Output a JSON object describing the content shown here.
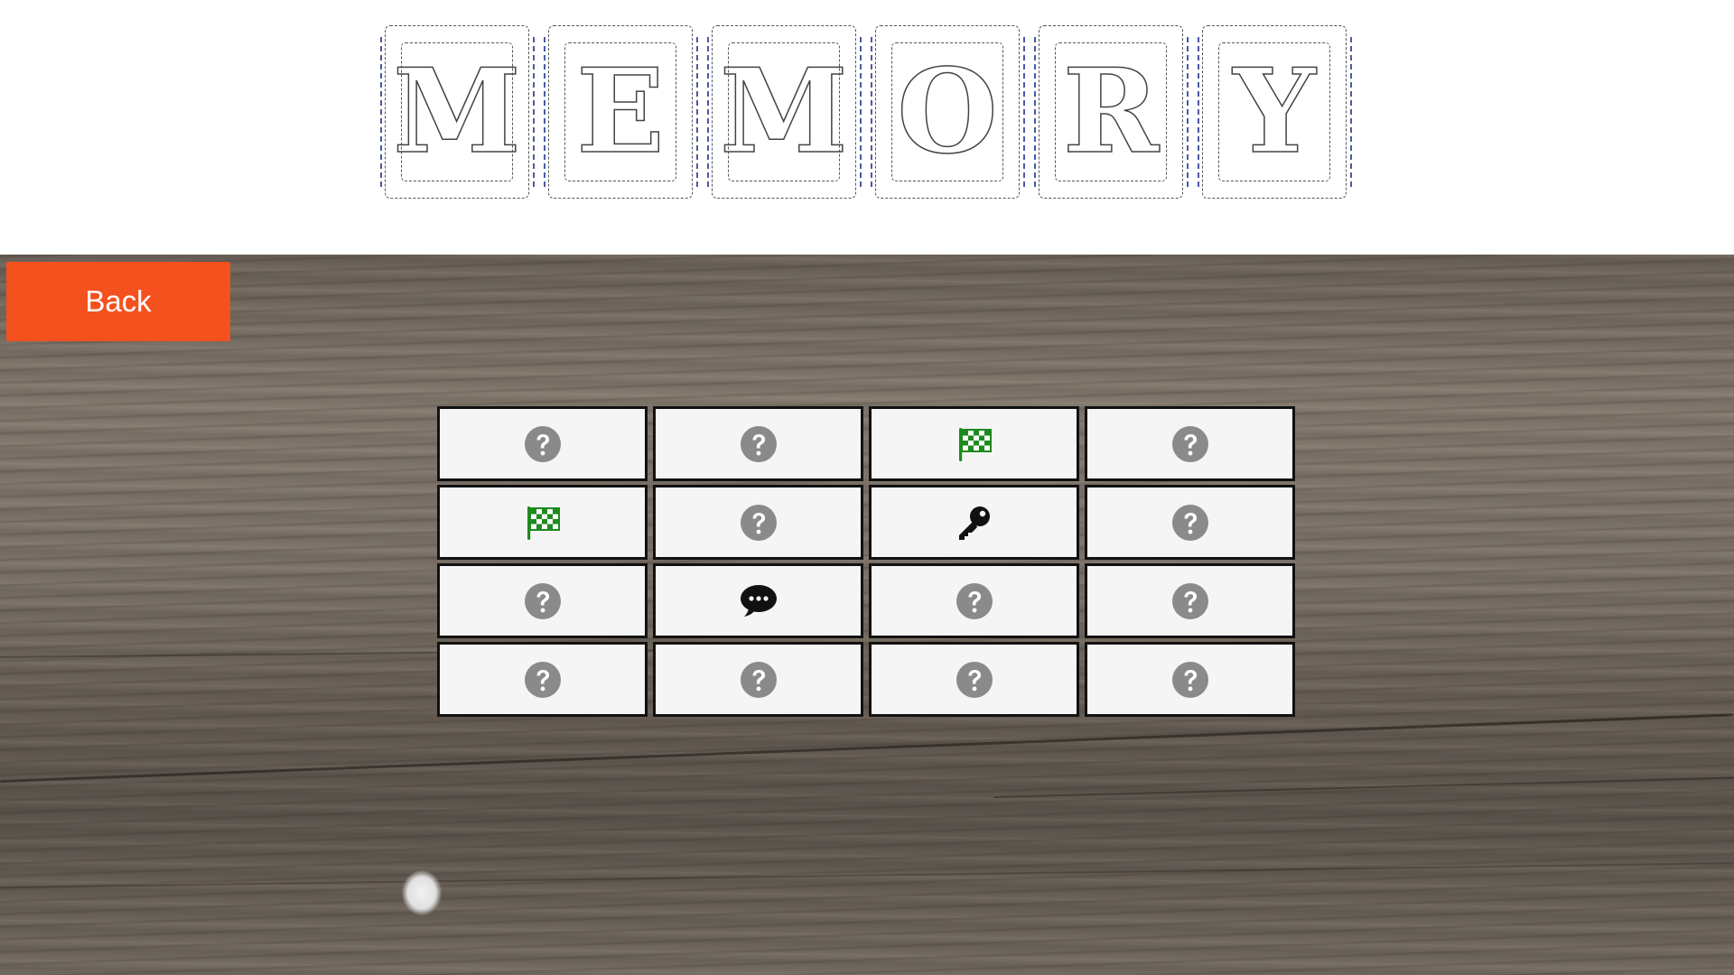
{
  "header": {
    "title_letters": [
      "M",
      "E",
      "M",
      "O",
      "R",
      "Y"
    ]
  },
  "back_button": {
    "label": "Back"
  },
  "board": {
    "rows": 4,
    "cols": 4,
    "cards": [
      {
        "state": "hidden",
        "icon": "question-icon"
      },
      {
        "state": "hidden",
        "icon": "question-icon"
      },
      {
        "state": "revealed",
        "icon": "checkered-flag-icon"
      },
      {
        "state": "hidden",
        "icon": "question-icon"
      },
      {
        "state": "revealed",
        "icon": "checkered-flag-icon"
      },
      {
        "state": "hidden",
        "icon": "question-icon"
      },
      {
        "state": "revealed",
        "icon": "key-icon"
      },
      {
        "state": "hidden",
        "icon": "question-icon"
      },
      {
        "state": "hidden",
        "icon": "question-icon"
      },
      {
        "state": "revealed",
        "icon": "speech-bubble-icon"
      },
      {
        "state": "hidden",
        "icon": "question-icon"
      },
      {
        "state": "hidden",
        "icon": "question-icon"
      },
      {
        "state": "hidden",
        "icon": "question-icon"
      },
      {
        "state": "hidden",
        "icon": "question-icon"
      },
      {
        "state": "hidden",
        "icon": "question-icon"
      },
      {
        "state": "hidden",
        "icon": "question-icon"
      }
    ]
  },
  "colors": {
    "back_button": "#f4511e",
    "card_face": "#f5f5f5",
    "question_icon": "#8a8a8a",
    "flag_icon": "#1e8a1e",
    "key_icon": "#111111",
    "speech_icon": "#111111"
  }
}
